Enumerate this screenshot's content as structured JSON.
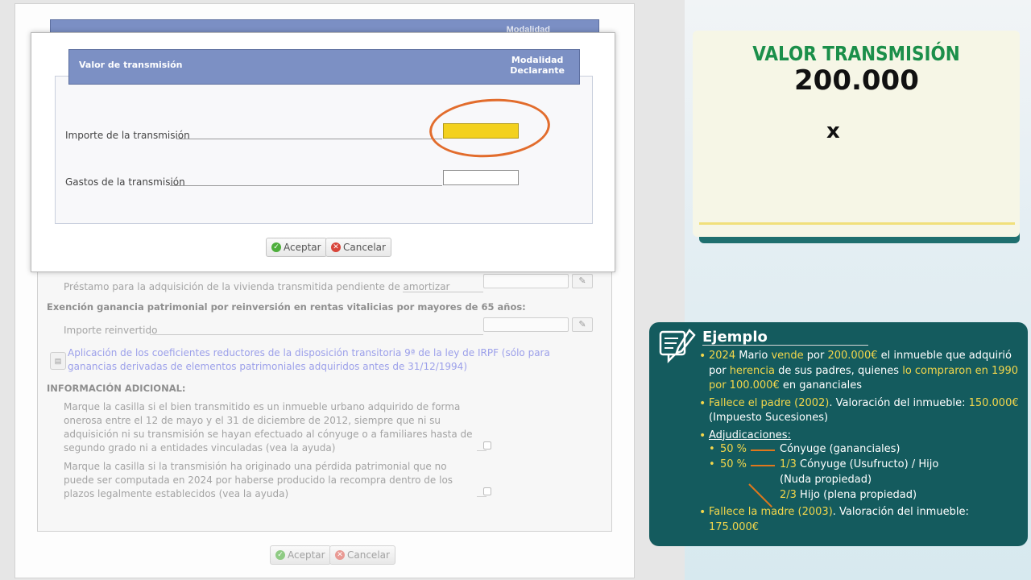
{
  "background_form": {
    "header_modalidad": "Modalidad",
    "prestamo_label": "Préstamo para la adquisición de la vivienda transmitida pendiente de amortizar",
    "exencion_title": "Exención ganancia patrimonial por reinversión en rentas vitalicias por mayores de 65 años:",
    "importe_reinvertido_label": "Importe reinvertido",
    "link_text": "Aplicación de los coeficientes reductores de la disposición transitoria 9ª de la ley de IRPF (sólo para ganancias derivadas de elementos patrimoniales adquiridos antes de 31/12/1994)",
    "info_title": "INFORMACIÓN ADICIONAL:",
    "checkbox1_text": "Marque la casilla si el bien transmitido es un inmueble urbano adquirido de forma onerosa entre el 12 de mayo y el 31 de diciembre de 2012, siempre que ni su adquisición ni su transmisión se hayan efectuado al cónyuge o a familiares hasta de segundo grado ni a entidades vinculadas (vea la ayuda)",
    "checkbox2_text": "Marque la casilla si la transmisión ha originado una pérdida patrimonial que no puede ser computada en 2024 por haberse producido la recompra dentro de los plazos legalmente establecidos (vea la ayuda)",
    "accept_label": "Aceptar",
    "cancel_label": "Cancelar"
  },
  "modal": {
    "header_title": "Valor de transmisión",
    "header_mod_1": "Modalidad",
    "header_mod_2": "Declarante",
    "importe_label": "Importe de la transmisión",
    "importe_value": "",
    "gastos_label": "Gastos de la transmisión",
    "gastos_value": "",
    "accept_label": "Aceptar",
    "cancel_label": "Cancelar"
  },
  "valor_card": {
    "title": "VALOR TRANSMISIÓN",
    "amount": "200.000",
    "operator": "x"
  },
  "ejemplo": {
    "title": "Ejemplo",
    "b1_p1": "2024",
    "b1_p2": " Mario ",
    "b1_p3": "vende",
    "b1_p4": " por ",
    "b1_p5": "200.000€",
    "b1_p6": " el inmueble que adquirió por ",
    "b1_p7": "herencia",
    "b1_p8": " de sus padres, quienes ",
    "b1_p9": "lo compraron en 1990 por 100.000€",
    "b1_p10": " en gananciales",
    "b2_p1": "Fallece el padre (2002)",
    "b2_p2": ". Valoración del inmueble: ",
    "b2_p3": "150.000€",
    "b2_p4": " (Impuesto Sucesiones)",
    "b3": "Adjudicaciones:",
    "s1_pct": "50 %",
    "s1_text": "Cónyuge (gananciales)",
    "s2_pct": "50 %",
    "s2_frac1": "1/3",
    "s2_text1": " Cónyuge (Usufructo) / Hijo",
    "s2_text2": "(Nuda propiedad)",
    "s3_frac": "2/3",
    "s3_text": " Hijo (plena propiedad)",
    "b4_p1": "Fallece la madre (2003)",
    "b4_p2": ". Valoración del inmueble: ",
    "b4_p3": "175.000€"
  },
  "colors": {
    "header_blue": "#7c90c4",
    "highlight_yellow": "#f3d11e",
    "annotation_orange": "#e26c2c",
    "card_teal": "#145b5e",
    "title_green": "#1b8f4a",
    "accent_yellow": "#f2d64b"
  }
}
